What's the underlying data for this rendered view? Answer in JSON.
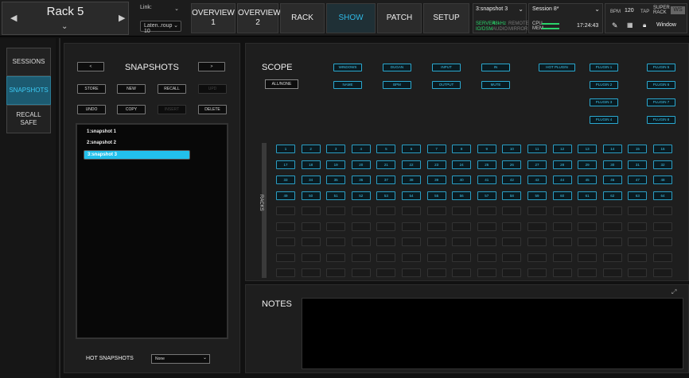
{
  "header": {
    "rack_name": "Rack 5",
    "link_label": "Link:",
    "group_value": "Laten..roup 10",
    "nav": [
      {
        "line1": "OVERVIEW",
        "line2": "1"
      },
      {
        "line1": "OVERVIEW",
        "line2": "2"
      },
      {
        "line1": "RACK",
        "line2": ""
      },
      {
        "line1": "SHOW",
        "line2": ""
      },
      {
        "line1": "PATCH",
        "line2": ""
      },
      {
        "line1": "SETUP",
        "line2": ""
      }
    ],
    "snapshot_select": "3:snapshot 3",
    "session_select": "Session 8*",
    "server_status": "SERVER",
    "server_sub": "IO/DSM",
    "sample_rate": "48kHz",
    "audio_label": "AUDIO",
    "remote_label": "REMOTE",
    "mirror_label": "MIRROR",
    "cpu_label": "CPU",
    "mem_label": "MEM",
    "time": "17:24:43",
    "bpm_label": "BPM",
    "bpm": "120",
    "tap": "TAP",
    "brand_line1": "SUPER",
    "brand_line2": "RACK",
    "brand_badge": "WS",
    "window_select": "Window"
  },
  "sidebar": {
    "sessions": "SESSIONS",
    "snapshots": "SNAPSHOTS",
    "recall_safe_1": "RECALL",
    "recall_safe_2": "SAFE"
  },
  "snapshots_panel": {
    "title": "SNAPSHOTS",
    "prev": "<",
    "next": ">",
    "store": "STORE",
    "new": "NEW",
    "recall": "RECALL",
    "undo_disabled": "UPD",
    "undo": "UNDO",
    "copy": "COPY",
    "insert": "INSERT",
    "delete": "DELETE",
    "items": [
      "1:snapshot 1",
      "2:snapshot 2",
      "3:snapshot 3"
    ],
    "hot_label": "HOT SNAPSHOTS",
    "hot_value": "None"
  },
  "scope": {
    "title": "SCOPE",
    "all_none": "ALL/NONE",
    "buttons_row1": [
      "WINDOWS",
      "DUGAN",
      "INPUT",
      "IN"
    ],
    "buttons_row2": [
      "NAME",
      "BPM",
      "OUTPUT",
      "MUTE"
    ],
    "hot_plugin": "HOT PLUGIN",
    "plugins_left": [
      "PLUGIN 1",
      "PLUGIN 2",
      "PLUGIN 3",
      "PLUGIN 4"
    ],
    "plugins_right": [
      "PLUGIN 5",
      "PLUGIN 6",
      "PLUGIN 7",
      "PLUGIN 8"
    ],
    "racks_label": "RACKS",
    "rack_numbers": [
      "1",
      "2",
      "3",
      "4",
      "5",
      "6",
      "7",
      "8",
      "9",
      "10",
      "11",
      "12",
      "13",
      "14",
      "15",
      "16",
      "17",
      "18",
      "19",
      "20",
      "21",
      "22",
      "23",
      "24",
      "25",
      "26",
      "27",
      "28",
      "29",
      "30",
      "31",
      "32",
      "33",
      "34",
      "35",
      "36",
      "37",
      "38",
      "39",
      "40",
      "41",
      "42",
      "43",
      "44",
      "45",
      "46",
      "47",
      "48",
      "49",
      "50",
      "51",
      "52",
      "53",
      "54",
      "55",
      "56",
      "57",
      "58",
      "59",
      "60",
      "61",
      "62",
      "63",
      "64"
    ]
  },
  "notes": {
    "title": "NOTES"
  },
  "colors": {
    "accent": "#22c0ec",
    "active_nav": "#2fb9e6"
  }
}
